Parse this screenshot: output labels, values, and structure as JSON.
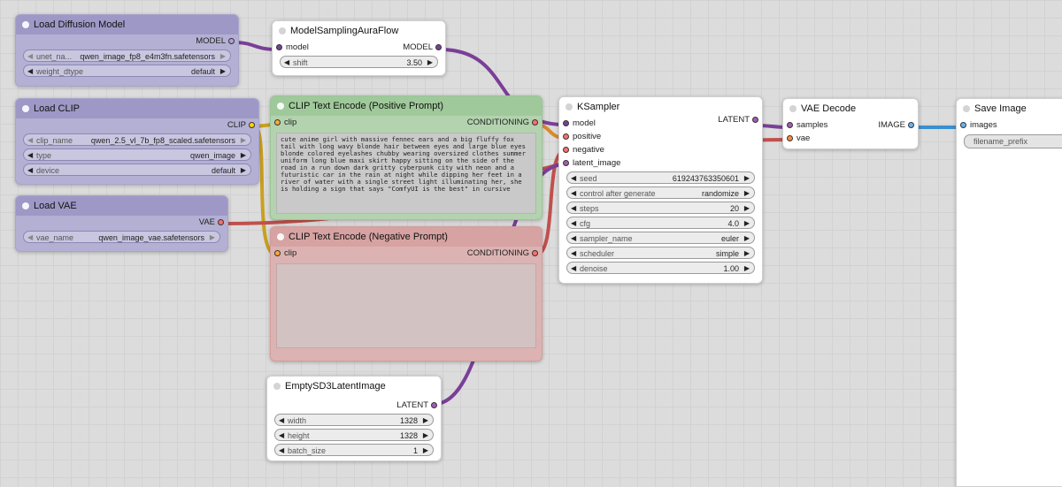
{
  "nodes": {
    "load_diffusion": {
      "title": "Load Diffusion Model",
      "output": "MODEL",
      "widgets": [
        {
          "label": "unet_na...",
          "value": "qwen_image_fp8_e4m3fn.safetensors"
        },
        {
          "label": "weight_dtype",
          "value": "default"
        }
      ]
    },
    "load_clip": {
      "title": "Load CLIP",
      "output": "CLIP",
      "widgets": [
        {
          "label": "clip_name",
          "value": "qwen_2.5_vl_7b_fp8_scaled.safetensors"
        },
        {
          "label": "type",
          "value": "qwen_image"
        },
        {
          "label": "device",
          "value": "default"
        }
      ]
    },
    "load_vae": {
      "title": "Load VAE",
      "output": "VAE",
      "widgets": [
        {
          "label": "vae_name",
          "value": "qwen_image_vae.safetensors"
        }
      ]
    },
    "model_sampling": {
      "title": "ModelSamplingAuraFlow",
      "input": "model",
      "output": "MODEL",
      "widgets": [
        {
          "label": "shift",
          "value": "3.50"
        }
      ]
    },
    "clip_positive": {
      "title": "CLIP Text Encode (Positive Prompt)",
      "input": "clip",
      "output": "CONDITIONING",
      "text": "cute anime girl with massive fennec ears and a big fluffy fox tail with long wavy blonde hair between eyes and large blue eyes blonde colored eyelashes chubby wearing oversized clothes summer uniform long blue maxi skirt happy sitting on the side of the road in a run down dark gritty cyberpunk city with neon and a futuristic car in the rain at night while dipping her feet in a river of water with a single street light illuminating her, she is holding a sign that says \"ComfyUI is the best\" in cursive"
    },
    "clip_negative": {
      "title": "CLIP Text Encode (Negative Prompt)",
      "input": "clip",
      "output": "CONDITIONING",
      "text": ""
    },
    "empty_latent": {
      "title": "EmptySD3LatentImage",
      "output": "LATENT",
      "widgets": [
        {
          "label": "width",
          "value": "1328"
        },
        {
          "label": "height",
          "value": "1328"
        },
        {
          "label": "batch_size",
          "value": "1"
        }
      ]
    },
    "ksampler": {
      "title": "KSampler",
      "inputs": [
        "model",
        "positive",
        "negative",
        "latent_image"
      ],
      "output": "LATENT",
      "widgets": [
        {
          "label": "seed",
          "value": "619243763350601"
        },
        {
          "label": "control after generate",
          "value": "randomize"
        },
        {
          "label": "steps",
          "value": "20"
        },
        {
          "label": "cfg",
          "value": "4.0"
        },
        {
          "label": "sampler_name",
          "value": "euler"
        },
        {
          "label": "scheduler",
          "value": "simple"
        },
        {
          "label": "denoise",
          "value": "1.00"
        }
      ]
    },
    "vae_decode": {
      "title": "VAE Decode",
      "inputs": [
        "samples",
        "vae"
      ],
      "output": "IMAGE"
    },
    "save_image": {
      "title": "Save Image",
      "input": "images",
      "widget_label": "filename_prefix"
    }
  },
  "icons": {
    "arrow_left": "◀",
    "arrow_right": "▶"
  },
  "colors": {
    "model": "#b39ddb",
    "clip": "#ffd500",
    "vae": "#ff6e6e",
    "conditioning": "#ffa931",
    "latent": "#ff9cf9",
    "image": "#64b5f6",
    "model_wire": "#9b59b6",
    "latent_wire": "#a25cb5"
  }
}
